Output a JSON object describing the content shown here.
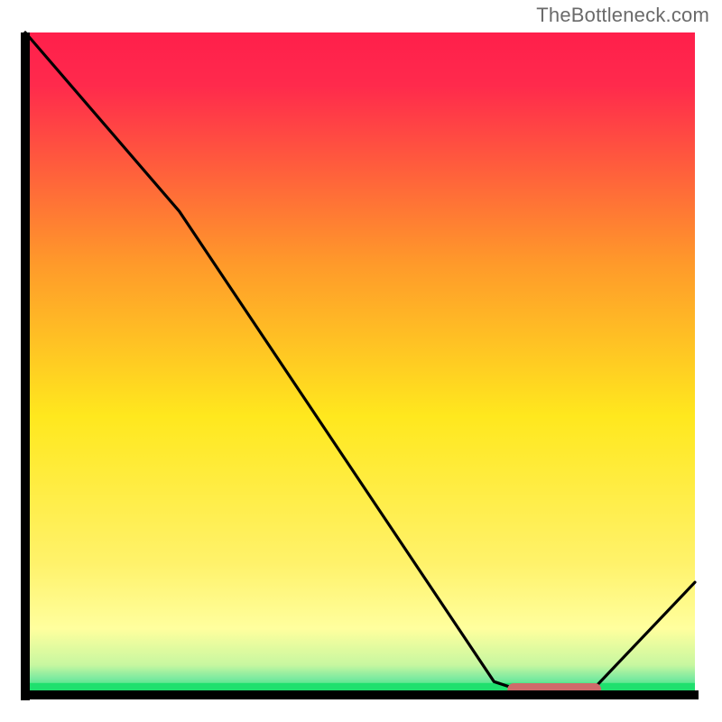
{
  "watermark": "TheBottleneck.com",
  "chart_data": {
    "type": "line",
    "title": "",
    "xlabel": "",
    "ylabel": "",
    "xlim": [
      0,
      100
    ],
    "ylim": [
      0,
      100
    ],
    "x": [
      0,
      23,
      70,
      76,
      84,
      100
    ],
    "values": [
      100,
      73,
      2,
      0,
      0,
      17
    ],
    "optimal_zone": {
      "x_start": 72,
      "x_end": 86
    },
    "colors": {
      "top": "#ff1f4b",
      "mid_upper": "#ff9a2a",
      "mid": "#ffe81e",
      "mid_lower": "#ffff9e",
      "bottom": "#1fe06e",
      "axis": "#000000",
      "curve": "#000000",
      "marker": "#cf6a6a"
    }
  }
}
